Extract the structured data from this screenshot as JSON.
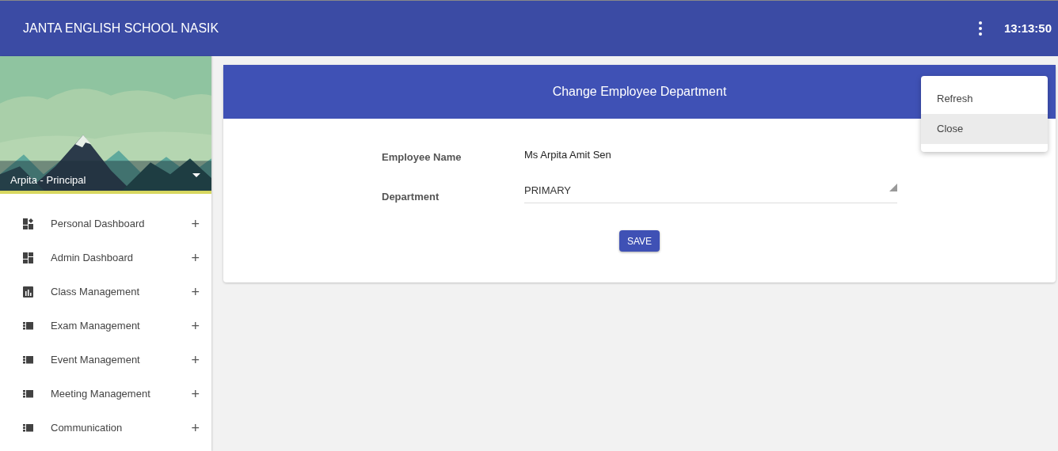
{
  "header": {
    "title": "JANTA ENGLISH SCHOOL NASIK",
    "time": "13:13:50"
  },
  "profile": {
    "name": "Arpita - Principal"
  },
  "sidebar": {
    "items": [
      {
        "label": "Personal Dashboard",
        "kind": "dashboard-star",
        "expand": "+"
      },
      {
        "label": "Admin Dashboard",
        "kind": "dashboard",
        "expand": "+"
      },
      {
        "label": "Class Management",
        "kind": "chart",
        "expand": "+"
      },
      {
        "label": "Exam Management",
        "kind": "list",
        "expand": "+"
      },
      {
        "label": "Event Management",
        "kind": "list",
        "expand": "+"
      },
      {
        "label": "Meeting Management",
        "kind": "list",
        "expand": "+"
      },
      {
        "label": "Communication",
        "kind": "list",
        "expand": "+"
      }
    ]
  },
  "card": {
    "title": "Change Employee Department",
    "fields": [
      {
        "label": "Employee Name",
        "kind": "text",
        "value": "Ms Arpita Amit Sen"
      },
      {
        "label": "Department",
        "kind": "select",
        "value": "PRIMARY"
      }
    ],
    "button": "SAVE"
  },
  "menu": {
    "items": [
      {
        "label": "Refresh",
        "selected": false
      },
      {
        "label": "Close",
        "selected": true
      }
    ]
  }
}
